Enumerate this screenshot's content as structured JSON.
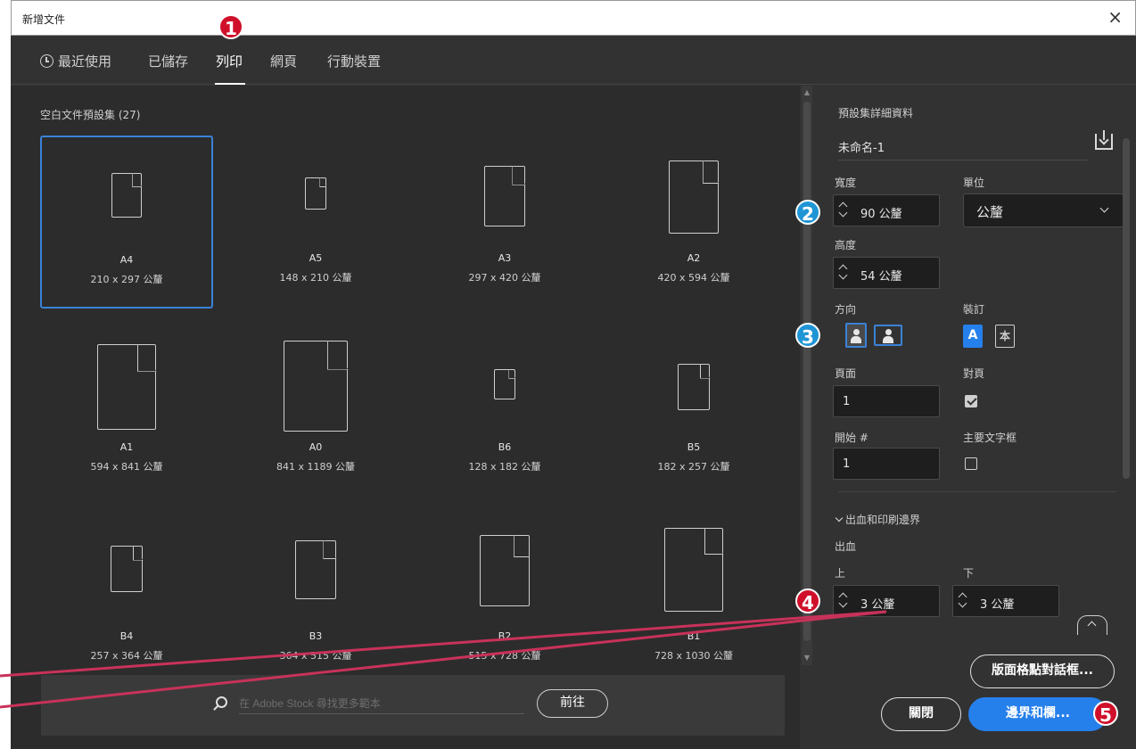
{
  "window": {
    "title": "新增文件",
    "close_glyph": "×"
  },
  "tabs": [
    {
      "label": "最近使用",
      "icon": "clock-icon"
    },
    {
      "label": "已儲存"
    },
    {
      "label": "列印",
      "active": true
    },
    {
      "label": "網頁"
    },
    {
      "label": "行動裝置"
    }
  ],
  "presets": {
    "title": "空白文件預設集 (27)",
    "items": [
      {
        "name": "A4",
        "size": "210 x 297 公釐",
        "selected": true
      },
      {
        "name": "A5",
        "size": "148 x 210 公釐"
      },
      {
        "name": "A3",
        "size": "297 x 420 公釐"
      },
      {
        "name": "A2",
        "size": "420 x 594 公釐"
      },
      {
        "name": "A1",
        "size": "594 x 841 公釐"
      },
      {
        "name": "A0",
        "size": "841 x 1189 公釐"
      },
      {
        "name": "B6",
        "size": "128 x 182 公釐"
      },
      {
        "name": "B5",
        "size": "182 x 257 公釐"
      },
      {
        "name": "B4",
        "size": "257 x 364 公釐"
      },
      {
        "name": "B3",
        "size": "364 x 515 公釐"
      },
      {
        "name": "B2",
        "size": "515 x 728 公釐"
      },
      {
        "name": "B1",
        "size": "728 x 1030 公釐"
      }
    ]
  },
  "search": {
    "placeholder": "在 Adobe Stock 尋找更多範本",
    "go_label": "前往"
  },
  "details": {
    "title": "預設集詳細資料",
    "preset_name": "未命名-1",
    "width_label": "寬度",
    "width_value": "90 公釐",
    "units_label": "單位",
    "units_value": "公釐",
    "height_label": "高度",
    "height_value": "54 公釐",
    "orientation_label": "方向",
    "binding_label": "裝訂",
    "binding_ltr": "A",
    "binding_rtl": "本",
    "pages_label": "頁面",
    "pages_value": "1",
    "facing_label": "對頁",
    "facing_checked": true,
    "start_label": "開始 #",
    "start_value": "1",
    "primary_frame_label": "主要文字框",
    "primary_frame_checked": false,
    "bleed_section": "出血和印刷邊界",
    "bleed_label": "出血",
    "bleed_top_label": "上",
    "bleed_top_value": "3 公釐",
    "bleed_bottom_label": "下",
    "bleed_bottom_value": "3 公釐"
  },
  "buttons": {
    "layout_grid": "版面格點對話框...",
    "close": "關閉",
    "margins": "邊界和欄..."
  },
  "markers": [
    "1",
    "2",
    "3",
    "4",
    "5"
  ],
  "colors": {
    "accent": "#2680eb",
    "selection": "#3a82d8",
    "marker_red": "#d0102a",
    "marker_blue": "#1f95d6",
    "annotation_line": "#c8325a"
  }
}
